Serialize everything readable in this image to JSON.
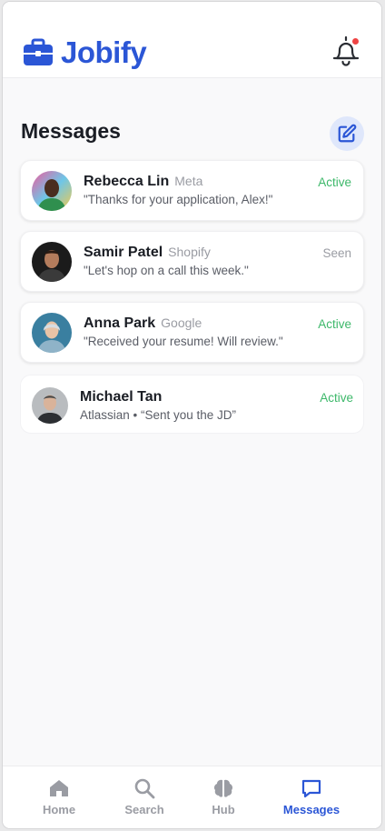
{
  "brand": {
    "name": "Jobify",
    "color": "#2b56d6",
    "icon": "briefcase-icon"
  },
  "header": {
    "notification_icon": "bell-icon",
    "has_unread": true
  },
  "section": {
    "title": "Messages",
    "compose_icon": "edit-icon"
  },
  "conversations": [
    {
      "name": "Rebecca Lin",
      "company": "Meta",
      "preview": "\"Thanks for your application, Alex!\"",
      "status": "Active"
    },
    {
      "name": "Samir Patel",
      "company": "Shopify",
      "preview": "\"Let's hop on a call this week.\"",
      "status": "Seen"
    },
    {
      "name": "Anna Park",
      "company": "Google",
      "preview": "\"Received your resume! Will review.\"",
      "status": "Active"
    },
    {
      "name": "Michael Tan",
      "preview": "Atlassian • “Sent you the JD”",
      "status": "Active"
    }
  ],
  "nav": {
    "items": [
      {
        "label": "Home",
        "icon": "home-icon"
      },
      {
        "label": "Search",
        "icon": "search-icon"
      },
      {
        "label": "Hub",
        "icon": "brain-icon"
      },
      {
        "label": "Messages",
        "icon": "message-icon"
      }
    ],
    "current": "Messages"
  },
  "colors": {
    "accent": "#2b56d6",
    "active_status": "#3db86a",
    "muted": "#9a9ca3",
    "notification_dot": "#ef4444"
  }
}
